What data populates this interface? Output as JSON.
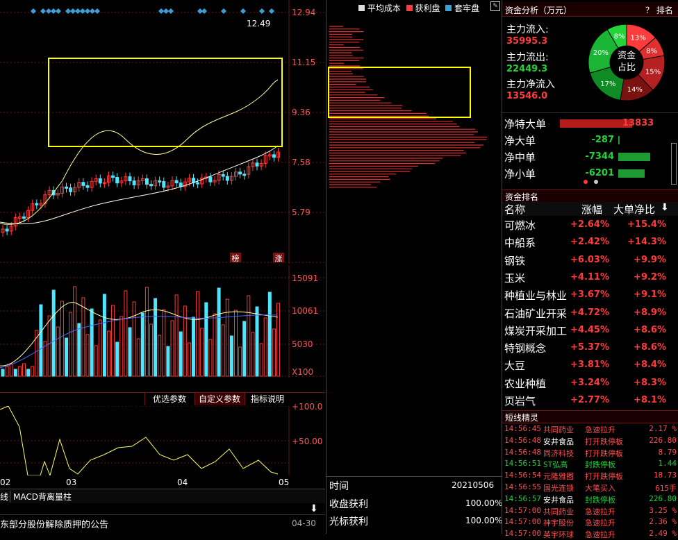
{
  "price_axis": [
    "12.94",
    "11.15",
    "9.36",
    "7.58",
    "5.79"
  ],
  "last_price": "12.49",
  "badges": {
    "b1": "榜",
    "b2": "涨"
  },
  "volume_axis": [
    "15091",
    "10061",
    "5030",
    "X100"
  ],
  "osc_axis": [
    "+100.0",
    "+50.00"
  ],
  "date_axis": [
    "02",
    "03",
    "04",
    "05"
  ],
  "buttons": {
    "preset": "优选参数",
    "custom": "自定义参数",
    "help": "指标说明"
  },
  "bottom_tabs": {
    "tab1": "线",
    "tab2": "MACD背离量柱"
  },
  "news": {
    "text": "东部分股份解除质押的公告",
    "date": "04-30"
  },
  "chip_legend": {
    "avg": "平均成本",
    "profit": "获利盘",
    "trapped": "套牢盘"
  },
  "chip_info": {
    "time_label": "时间",
    "time_value": "20210506",
    "close_label": "收盘获利",
    "close_value": "100.00%",
    "cursor_label": "光标获利",
    "cursor_value": "100.00%"
  },
  "fund": {
    "title": "资金分析（万元）",
    "help": "？ 排名",
    "in_label": "主力流入:",
    "in_value": "35995.3",
    "out_label": "主力流出:",
    "out_value": "22449.3",
    "net_label": "主力净流入",
    "net_value": "13546.0",
    "donut_center": [
      "资金",
      "占比"
    ],
    "donut_labels": [
      "13%",
      "8%",
      "15%",
      "14%",
      "17%",
      "20%",
      "8%"
    ]
  },
  "orders": [
    {
      "label": "净特大单",
      "value": "13833"
    },
    {
      "label": "净大单",
      "value": "-287"
    },
    {
      "label": "净中单",
      "value": "-7344"
    },
    {
      "label": "净小单",
      "value": "-6201"
    }
  ],
  "ranking": {
    "title": "资金排名",
    "headers": {
      "name": "名称",
      "change": "涨幅",
      "ratio": "大单净比"
    },
    "rows": [
      {
        "name": "可燃冰",
        "change": "+2.64%",
        "ratio": "+15.4%"
      },
      {
        "name": "中船系",
        "change": "+2.42%",
        "ratio": "+14.3%"
      },
      {
        "name": "钢铁",
        "change": "+6.03%",
        "ratio": "+9.9%"
      },
      {
        "name": "玉米",
        "change": "+4.11%",
        "ratio": "+9.2%"
      },
      {
        "name": "种植业与林业",
        "change": "+3.67%",
        "ratio": "+9.1%"
      },
      {
        "name": "石油矿业开采",
        "change": "+4.72%",
        "ratio": "+8.9%"
      },
      {
        "name": "煤炭开采加工",
        "change": "+4.45%",
        "ratio": "+8.6%"
      },
      {
        "name": "特钢概念",
        "change": "+5.37%",
        "ratio": "+8.6%"
      },
      {
        "name": "大豆",
        "change": "+3.81%",
        "ratio": "+8.4%"
      },
      {
        "name": "农业种植",
        "change": "+3.24%",
        "ratio": "+8.3%"
      },
      {
        "name": "页岩气",
        "change": "+2.77%",
        "ratio": "+8.1%"
      }
    ]
  },
  "sprite": {
    "title": "短线精灵",
    "rows": [
      {
        "time": "14:56:45",
        "name": "共同药业",
        "event": "急速拉升",
        "value": "2.17 %"
      },
      {
        "time": "14:56:48",
        "name": "安井食品",
        "event": "打开跌停板",
        "value": "226.80"
      },
      {
        "time": "14:56:48",
        "name": "同济科技",
        "event": "打开跌停板",
        "value": "8.79"
      },
      {
        "time": "14:56:51",
        "name": "ST弘高",
        "event": "封跌停板",
        "value": "1.44"
      },
      {
        "time": "14:56:54",
        "name": "元隆雅图",
        "event": "打开跌停板",
        "value": "18.73"
      },
      {
        "time": "14:56:55",
        "name": "国光连锁",
        "event": "大笔买入",
        "value": "615手"
      },
      {
        "time": "14:56:57",
        "name": "安井食品",
        "event": "封跌停板",
        "value": "226.80"
      },
      {
        "time": "14:57:00",
        "name": "共同药业",
        "event": "急速拉升",
        "value": "3.25 %"
      },
      {
        "time": "14:57:00",
        "name": "神宇股份",
        "event": "急速拉升",
        "value": "2.36 %"
      },
      {
        "time": "14:57:00",
        "name": "英宇环球",
        "event": "急速拉升",
        "value": "2.49 %"
      }
    ]
  },
  "colors": {
    "up": "#ff3b3b",
    "down": "#4fe5ff",
    "grid": "#6b1515",
    "highlight": "#ffff00"
  }
}
